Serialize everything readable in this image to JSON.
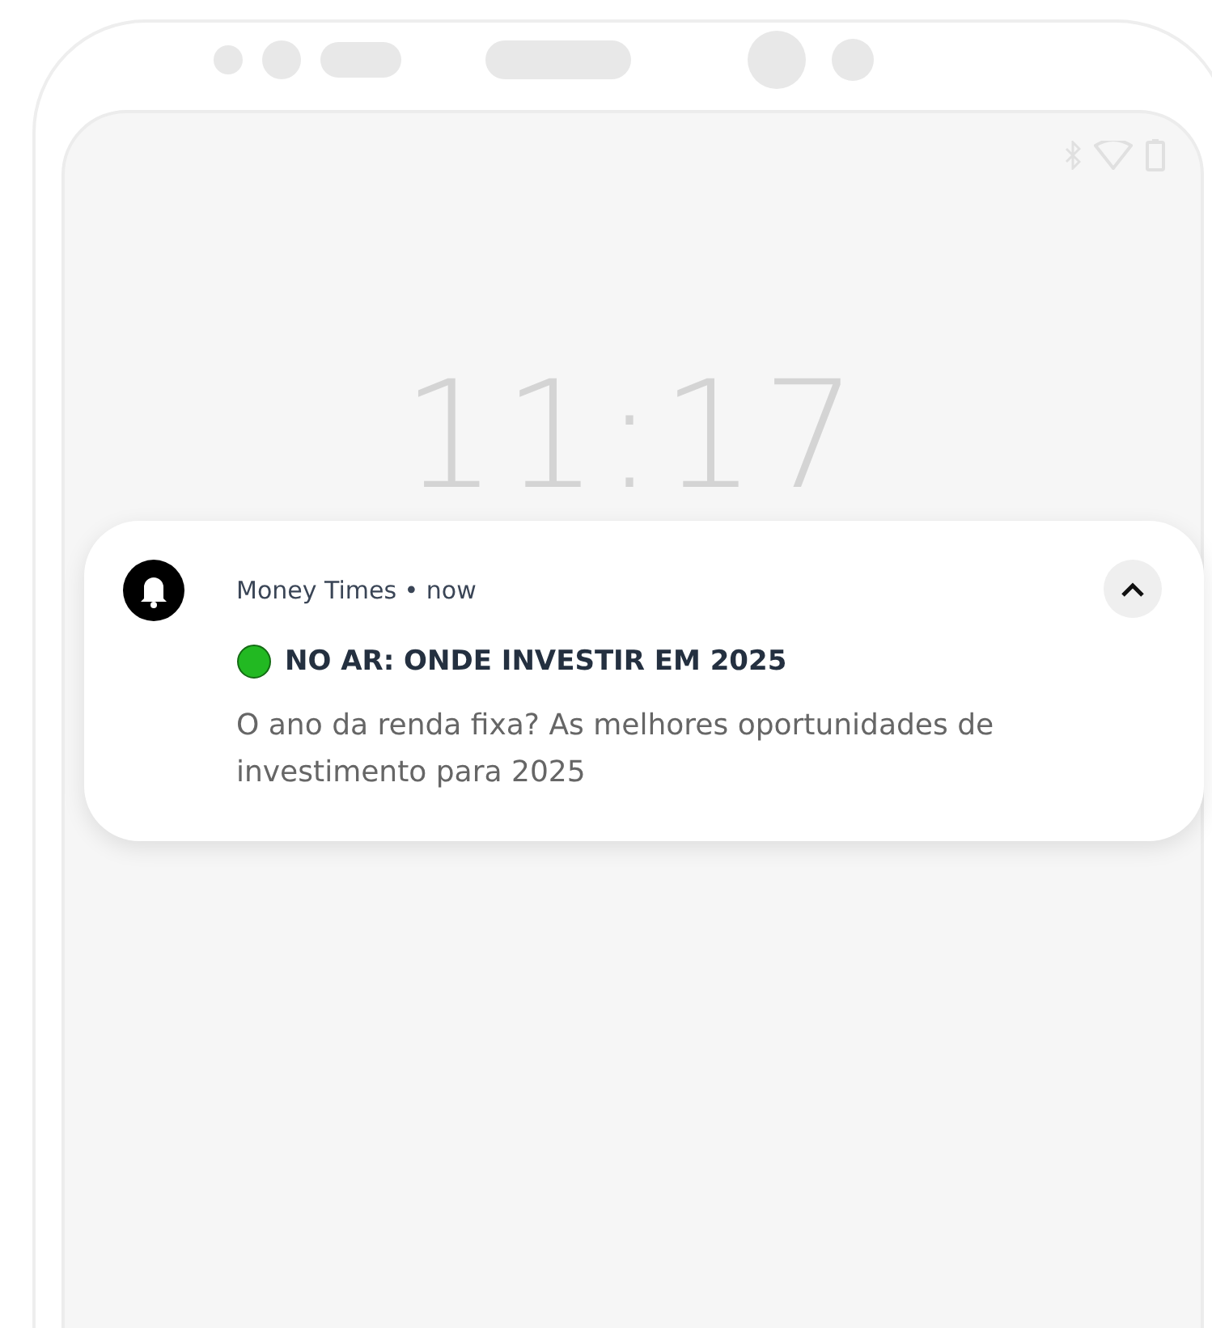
{
  "lock_screen": {
    "clock": "11:17"
  },
  "notification": {
    "header": "Money Times • now",
    "expanded": true,
    "title": "NO AR: ONDE INVESTIR EM 2025",
    "body": "O ano da renda fixa? As melhores oportunidades de investimento para 2025"
  }
}
